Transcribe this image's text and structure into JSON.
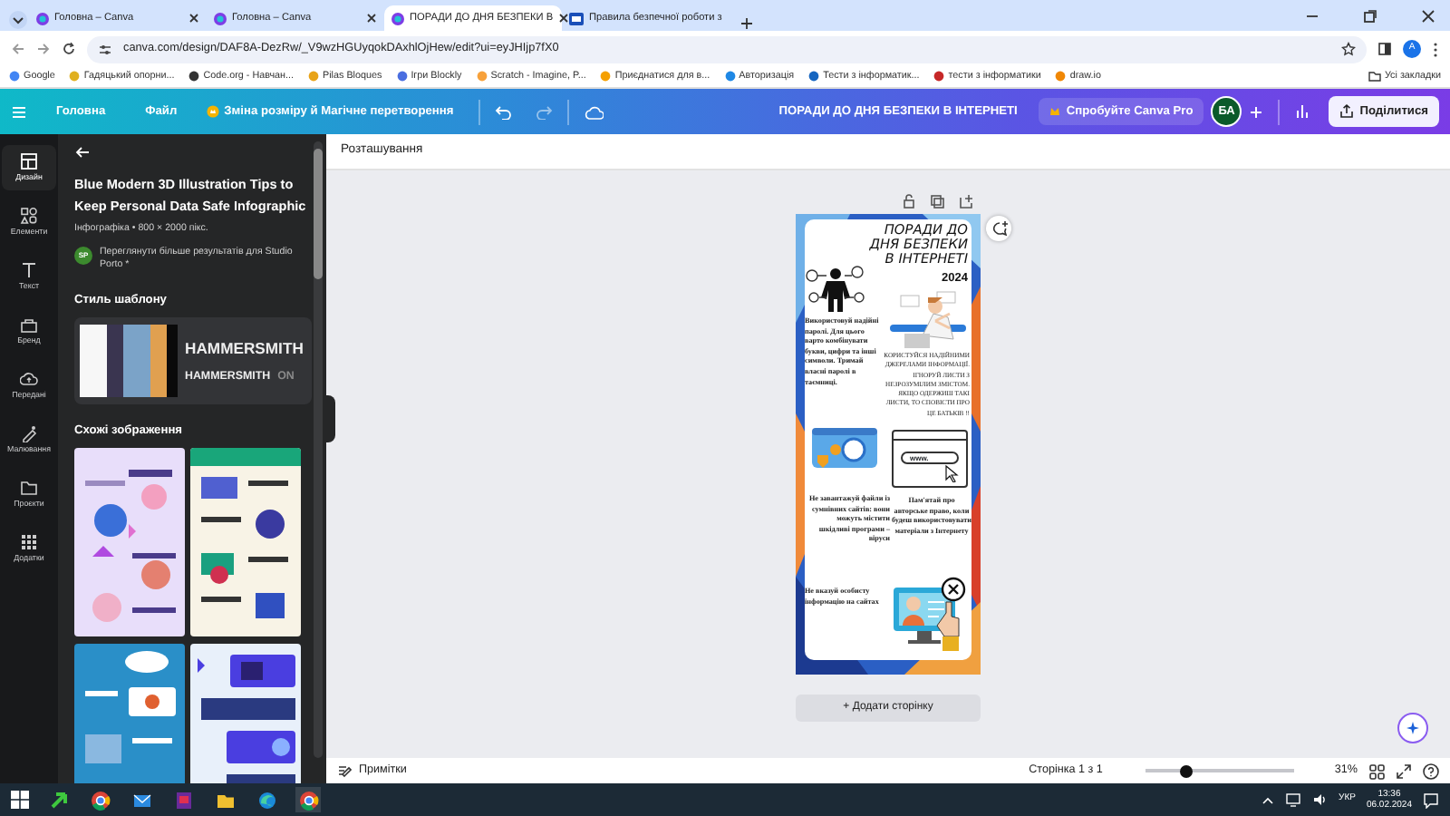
{
  "browser": {
    "tabs": [
      {
        "title": "Головна – Canva",
        "selected": false
      },
      {
        "title": "Головна – Canva",
        "selected": false
      },
      {
        "title": "ПОРАДИ ДО ДНЯ БЕЗПЕКИ В",
        "selected": true
      },
      {
        "title": "Правила безпечної роботи з",
        "selected": false
      }
    ],
    "url": "canva.com/design/DAF8A-DezRw/_V9wzHGUyqokDAxhlOjHew/edit?ui=eyJHIjp7fX0",
    "profile": "A",
    "bookmarks": [
      {
        "label": "Google",
        "color": "#4285f4"
      },
      {
        "label": "Гадяцький опорни...",
        "color": "#e0b020"
      },
      {
        "label": "Code.org - Навчан...",
        "color": "#333333"
      },
      {
        "label": "Pilas Bloques",
        "color": "#e8a317"
      },
      {
        "label": "Ігри Blockly",
        "color": "#4a6ee0"
      },
      {
        "label": "Scratch - Imagine, P...",
        "color": "#f7a13a"
      },
      {
        "label": "Приєднатися для в...",
        "color": "#f5a000"
      },
      {
        "label": "Авторизація",
        "color": "#1e88e5"
      },
      {
        "label": "Тести з інформатик...",
        "color": "#1565c0"
      },
      {
        "label": "тести з інформатики",
        "color": "#c62828"
      },
      {
        "label": "draw.io",
        "color": "#f08705"
      }
    ],
    "all_bookmarks": "Усі закладки"
  },
  "header": {
    "nav": [
      "Головна",
      "Файл"
    ],
    "magic": "Зміна розміру й Магічне перетворення",
    "design_title": "ПОРАДИ ДО ДНЯ БЕЗПЕКИ В ІНТЕРНЕТІ",
    "pro": "Спробуйте Canva Pro",
    "avatar": "БА",
    "share": "Поділитися"
  },
  "rail": [
    {
      "label": "Дизайн",
      "selected": true
    },
    {
      "label": "Елементи",
      "selected": false
    },
    {
      "label": "Текст",
      "selected": false
    },
    {
      "label": "Бренд",
      "selected": false
    },
    {
      "label": "Передані",
      "selected": false
    },
    {
      "label": "Малювання",
      "selected": false
    },
    {
      "label": "Проєкти",
      "selected": false
    },
    {
      "label": "Додатки",
      "selected": false
    }
  ],
  "panel": {
    "template_title": "Blue Modern 3D Illustration Tips to Keep Personal Data Safe Infographic",
    "meta": "Інфографіка • 800 × 2000 пікс.",
    "author_badge": "SP",
    "author_link": "Переглянути більше результатів для Studio Porto *",
    "style_heading": "Стиль шаблону",
    "swatches": [
      {
        "color": "#f7f7f7"
      },
      {
        "color": "#3a3550"
      },
      {
        "color": "#7ba3c8"
      },
      {
        "color": "#e0a050"
      },
      {
        "color": "#0a0a0a"
      }
    ],
    "font_samples": [
      {
        "text": "HAMMERSMITH",
        "kind": "heading"
      },
      {
        "text": "HAMMERSMITH",
        "kind": "subheading"
      },
      {
        "text": "ON",
        "kind": "muted"
      }
    ],
    "similar_heading": "Схожі зображення"
  },
  "workspace": {
    "toolbar_label": "Розташування",
    "page": {
      "title": "ПОРАДИ ДО ДНЯ БЕЗПЕКИ В ІНТЕРНЕТІ",
      "year": "2024",
      "url_text": "www.",
      "tips": [
        {
          "text": "Використовуй надійні паролі. Для цього варто комбінувати букви, цифри та інші символи. Тримай власні паролі в таємниці.",
          "kind": "left"
        },
        {
          "text": "КОРИСТУЙСЯ НАДІЙНИМИ ДЖЕРЕЛАМИ ІНФОРМАЦІЇ. ІГНОРУЙ ЛИСТИ З НЕЗРОЗУМІЛИМ ЗМІСТОМ. ЯКЩО ОДЕРЖИШ ТАКІ ЛИСТИ, ТО СПОВІСТИ ПРО ЦЕ БАТЬКІВ !!",
          "kind": "caps"
        },
        {
          "text": "Не завантажуй файли із сумнівних сайтів: вони можуть містити шкідливі програми – віруси",
          "kind": "right"
        },
        {
          "text": "Пам'ятай про авторське право, коли будеш використовувати матеріали з Інтернету",
          "kind": "center"
        },
        {
          "text": "Не вказуй особисту інформацію на сайтах",
          "kind": "left"
        }
      ]
    },
    "add_page": "+ Додати сторінку"
  },
  "footer": {
    "notes": "Примітки",
    "page_count": "Сторінка 1 з 1",
    "zoom": {
      "level": 0.27
    },
    "zoom_text": "31%"
  },
  "taskbar": {
    "language": "УКР",
    "time": "13:36",
    "date": "06.02.2024"
  }
}
